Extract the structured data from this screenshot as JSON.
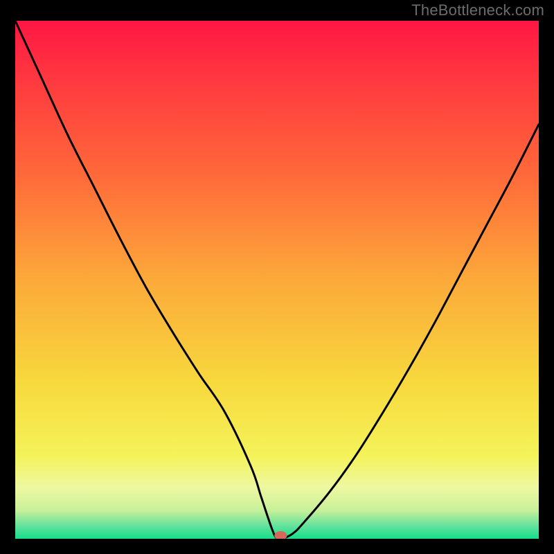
{
  "watermark": "TheBottleneck.com",
  "chart_data": {
    "type": "line",
    "title": "",
    "xlabel": "",
    "ylabel": "",
    "xlim": [
      0,
      100
    ],
    "ylim": [
      0,
      100
    ],
    "grid": false,
    "legend": false,
    "series": [
      {
        "name": "curve",
        "x": [
          0,
          5,
          10,
          15,
          20,
          25,
          30,
          35,
          40,
          45,
          47,
          49,
          50,
          51,
          53,
          55,
          60,
          65,
          70,
          75,
          80,
          85,
          90,
          95,
          100
        ],
        "values": [
          100,
          89,
          78,
          68,
          58,
          48.5,
          40,
          32,
          24.5,
          14,
          8,
          2,
          0,
          0,
          1,
          3,
          9,
          16,
          24,
          32.5,
          41.5,
          51,
          60.5,
          70,
          80
        ]
      }
    ],
    "marker": {
      "x": 50.7,
      "y": 0.6,
      "color": "#d6675a"
    },
    "background_gradient": {
      "stops": [
        {
          "pos": 0.0,
          "color": "#ff1744"
        },
        {
          "pos": 0.12,
          "color": "#ff3a3f"
        },
        {
          "pos": 0.3,
          "color": "#ff6a3a"
        },
        {
          "pos": 0.5,
          "color": "#fca93a"
        },
        {
          "pos": 0.7,
          "color": "#f7d93d"
        },
        {
          "pos": 0.84,
          "color": "#f4f35a"
        },
        {
          "pos": 0.9,
          "color": "#eef8a0"
        },
        {
          "pos": 0.945,
          "color": "#c9f09a"
        },
        {
          "pos": 0.975,
          "color": "#63e29c"
        },
        {
          "pos": 1.0,
          "color": "#15dd8a"
        }
      ]
    }
  }
}
